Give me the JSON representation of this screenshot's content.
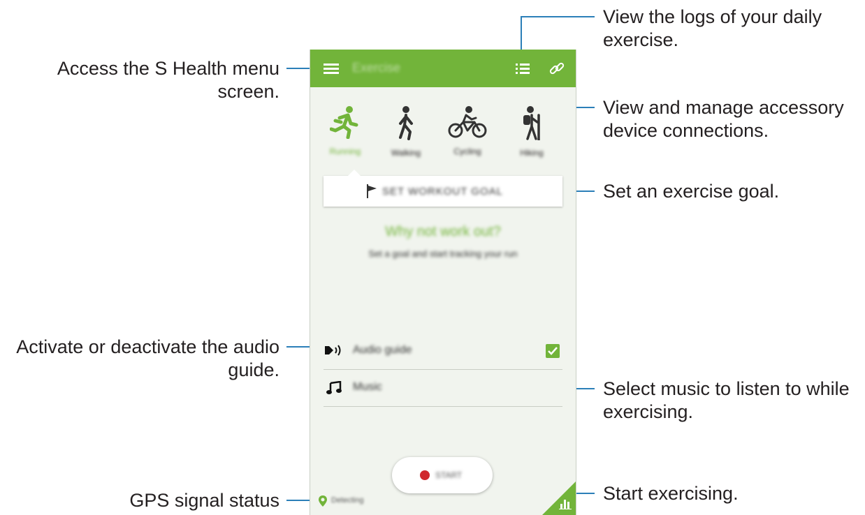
{
  "callouts": {
    "menu": "Access the S Health menu screen.",
    "logs": "View the logs of your daily exercise.",
    "accessory": "View and manage accessory device connections.",
    "goal": "Set an exercise goal.",
    "audio": "Activate or deactivate the audio guide.",
    "music": "Select music to listen to while exercising.",
    "start": "Start exercising.",
    "gps": "GPS signal status"
  },
  "app": {
    "title": "Exercise",
    "activities": [
      {
        "label": "Running",
        "icon": "running-icon"
      },
      {
        "label": "Walking",
        "icon": "walking-icon"
      },
      {
        "label": "Cycling",
        "icon": "cycling-icon"
      },
      {
        "label": "Hiking",
        "icon": "hiking-icon"
      }
    ],
    "goal_button": "SET WORKOUT GOAL",
    "prompt_title": "Why not work out?",
    "prompt_sub": "Set a goal and start tracking your run",
    "audio_guide": {
      "label": "Audio guide",
      "checked": true
    },
    "music_label": "Music",
    "start_label": "START",
    "gps_status": "Detecting",
    "accent": "#72b43a"
  },
  "colors": {
    "leader": "#2b7fb8",
    "start_dot": "#d0292e"
  }
}
